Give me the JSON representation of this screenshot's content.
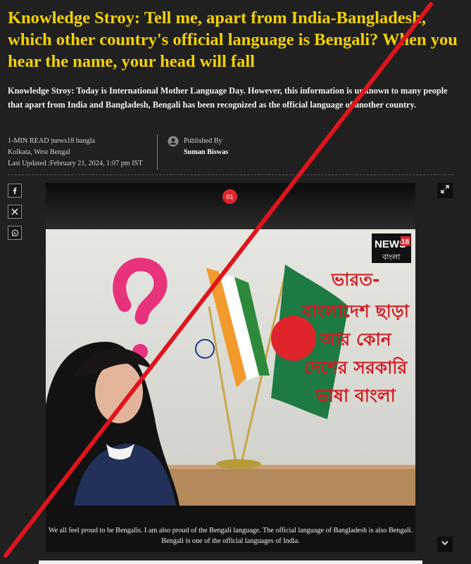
{
  "article": {
    "headline": "Knowledge Stroy: Tell me, apart from India-Bangladesh, which other country's official language is Bengali? When you hear the name, your head will fall",
    "summary": "Knowledge Stroy: Today is International Mother Language Day. However, this information is unknown to many people that apart from India and Bangladesh, Bengali has been recognized as the official language of another country."
  },
  "meta": {
    "read_source": "1-MIN READ |news18 bangla",
    "location": "Kolkata, West Bengal",
    "last_updated": "Last Updated :February 21, 2024, 1:07 pm IST",
    "published_label": "Published By",
    "author": "Suman Biswas"
  },
  "share": {
    "icons": [
      "facebook-icon",
      "x-icon",
      "whatsapp-icon"
    ]
  },
  "gallery": {
    "slide_number": "01",
    "caption": "We all feel proud to be Bengalis. I am also proud of the Bengali language. The official language of Bangladesh is also Bengali. Bengali is one of the official languages of India.",
    "logo_text": "NEWS",
    "logo_number": "18",
    "logo_sub": "বাংলা",
    "bengali_text": [
      "ভারত-",
      "বাংলাদেশ ছাড়া",
      "আর কোন",
      "দেশের সরকারি",
      "ভাষা বাংলা"
    ]
  },
  "colors": {
    "headline": "#f3d200",
    "background": "#202020",
    "badge": "#e0242c",
    "strike_line": "#e0141c",
    "bengali_text": "#d11c24"
  }
}
